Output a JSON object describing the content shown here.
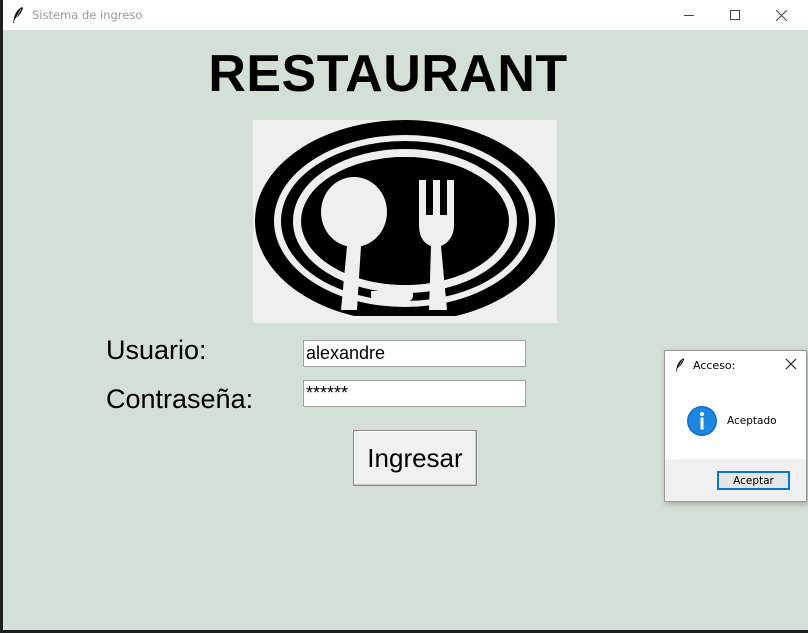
{
  "window": {
    "title": "Sistema de ingreso",
    "background": "#d3e0d7"
  },
  "main": {
    "heading": "RESTAURANT",
    "logo_icon": "spoon-fork-plate-icon",
    "username_label": "Usuario:",
    "username_value": "alexandre",
    "password_label": "Contraseña:",
    "password_value": "******",
    "submit_label": "Ingresar"
  },
  "dialog": {
    "title": "Acceso:",
    "icon": "info-icon",
    "message": "Aceptado",
    "ok_label": "Aceptar",
    "accent": "#0078d7"
  }
}
